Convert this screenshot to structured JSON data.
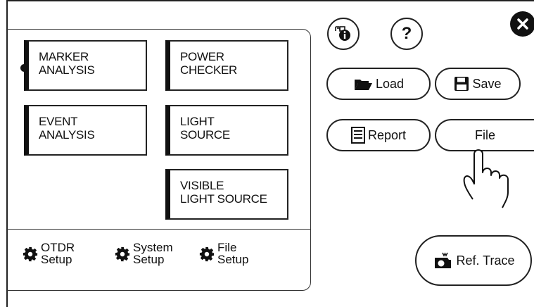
{
  "analysis_buttons": {
    "marker": {
      "line1": "MARKER",
      "line2": "ANALYSIS"
    },
    "power": {
      "line1": "POWER",
      "line2": "CHECKER"
    },
    "event": {
      "line1": "EVENT",
      "line2": "ANALYSIS"
    },
    "light": {
      "line1": "LIGHT",
      "line2": "SOURCE"
    },
    "visible": {
      "line1": "VISIBLE",
      "line2": "LIGHT SOURCE"
    }
  },
  "setup_items": [
    {
      "line1": "OTDR",
      "line2": "Setup",
      "icon": "gear-icon"
    },
    {
      "line1": "System",
      "line2": "Setup",
      "icon": "gear-icon"
    },
    {
      "line1": "File",
      "line2": "Setup",
      "icon": "gear-icon"
    }
  ],
  "right_panel": {
    "info_icon": "info-lock-icon",
    "help_label": "?",
    "load_label": "Load",
    "save_label": "Save",
    "report_label": "Report",
    "file_label": "File",
    "ref_trace_label": "Ref. Trace"
  },
  "close_icon": "close-icon"
}
